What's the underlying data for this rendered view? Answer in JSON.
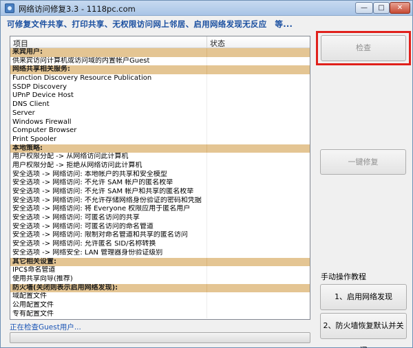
{
  "window": {
    "title": "网络访问修复3.3 - 1118pc.com",
    "minimize_glyph": "—",
    "maximize_glyph": "□",
    "close_glyph": "✕"
  },
  "banner": "可修复文件共享、打印共享、无权限访问网上邻居、启用网络发现无反应　等...",
  "list": {
    "columns": [
      "项目",
      "状态"
    ],
    "rows": [
      {
        "text": "来宾用户:",
        "category": true
      },
      {
        "text": "供来宾访问计算机或访问域的内置帐户Guest",
        "category": false
      },
      {
        "text": "网络共享相关服务:",
        "category": true
      },
      {
        "text": "Function Discovery Resource Publication",
        "category": false
      },
      {
        "text": "SSDP Discovery",
        "category": false
      },
      {
        "text": "UPnP Device Host",
        "category": false
      },
      {
        "text": "DNS Client",
        "category": false
      },
      {
        "text": "Server",
        "category": false
      },
      {
        "text": "Windows Firewall",
        "category": false
      },
      {
        "text": "Computer Browser",
        "category": false
      },
      {
        "text": "Print Spooler",
        "category": false
      },
      {
        "text": "本地策略:",
        "category": true
      },
      {
        "text": "用户权限分配 -> 从网络访问此计算机",
        "category": false
      },
      {
        "text": "用户权限分配 -> 拒绝从网络访问此计算机",
        "category": false
      },
      {
        "text": "安全选项 -> 网络访问: 本地帐户的共享和安全模型",
        "category": false
      },
      {
        "text": "安全选项 -> 网络访问: 不允许 SAM 帐户的匿名枚举",
        "category": false
      },
      {
        "text": "安全选项 -> 网络访问: 不允许 SAM 帐户和共享的匿名枚举",
        "category": false
      },
      {
        "text": "安全选项 -> 网络访问: 不允许存储网络身份验证的密码和凭据",
        "category": false
      },
      {
        "text": "安全选项 -> 网络访问: 将 Everyone 权限应用于匿名用户",
        "category": false
      },
      {
        "text": "安全选项 -> 网络访问: 可匿名访问的共享",
        "category": false
      },
      {
        "text": "安全选项 -> 网络访问: 可匿名访问的命名管道",
        "category": false
      },
      {
        "text": "安全选项 -> 网络访问: 限制对命名管道和共享的匿名访问",
        "category": false
      },
      {
        "text": "安全选项 -> 网络访问: 允许匿名 SID/名称转换",
        "category": false
      },
      {
        "text": "安全选项 -> 网络安全: LAN 管理器身份验证级别",
        "category": false
      },
      {
        "text": "其它相关设置:",
        "category": true
      },
      {
        "text": "IPC$命名管道",
        "category": false
      },
      {
        "text": "使用共享向导(推荐)",
        "category": false
      },
      {
        "text": "防火墙(关闭则表示启用网络发现):",
        "category": true
      },
      {
        "text": "域配置文件",
        "category": false
      },
      {
        "text": "公用配置文件",
        "category": false
      },
      {
        "text": "专有配置文件",
        "category": false
      }
    ]
  },
  "status_text": "正在检查Guest用户...",
  "progress": 0,
  "buttons": {
    "check": "检查",
    "one_click_fix": "一键修复",
    "manual_title": "手动操作教程",
    "enable_discovery": "1、启用网络发现",
    "firewall_restore": "2、防火墙恢复默认并关闭"
  },
  "colors": {
    "category_row": "#e4c593",
    "highlight": "#e0201b",
    "banner": "#1a4fa0",
    "status": "#1b55b5"
  }
}
